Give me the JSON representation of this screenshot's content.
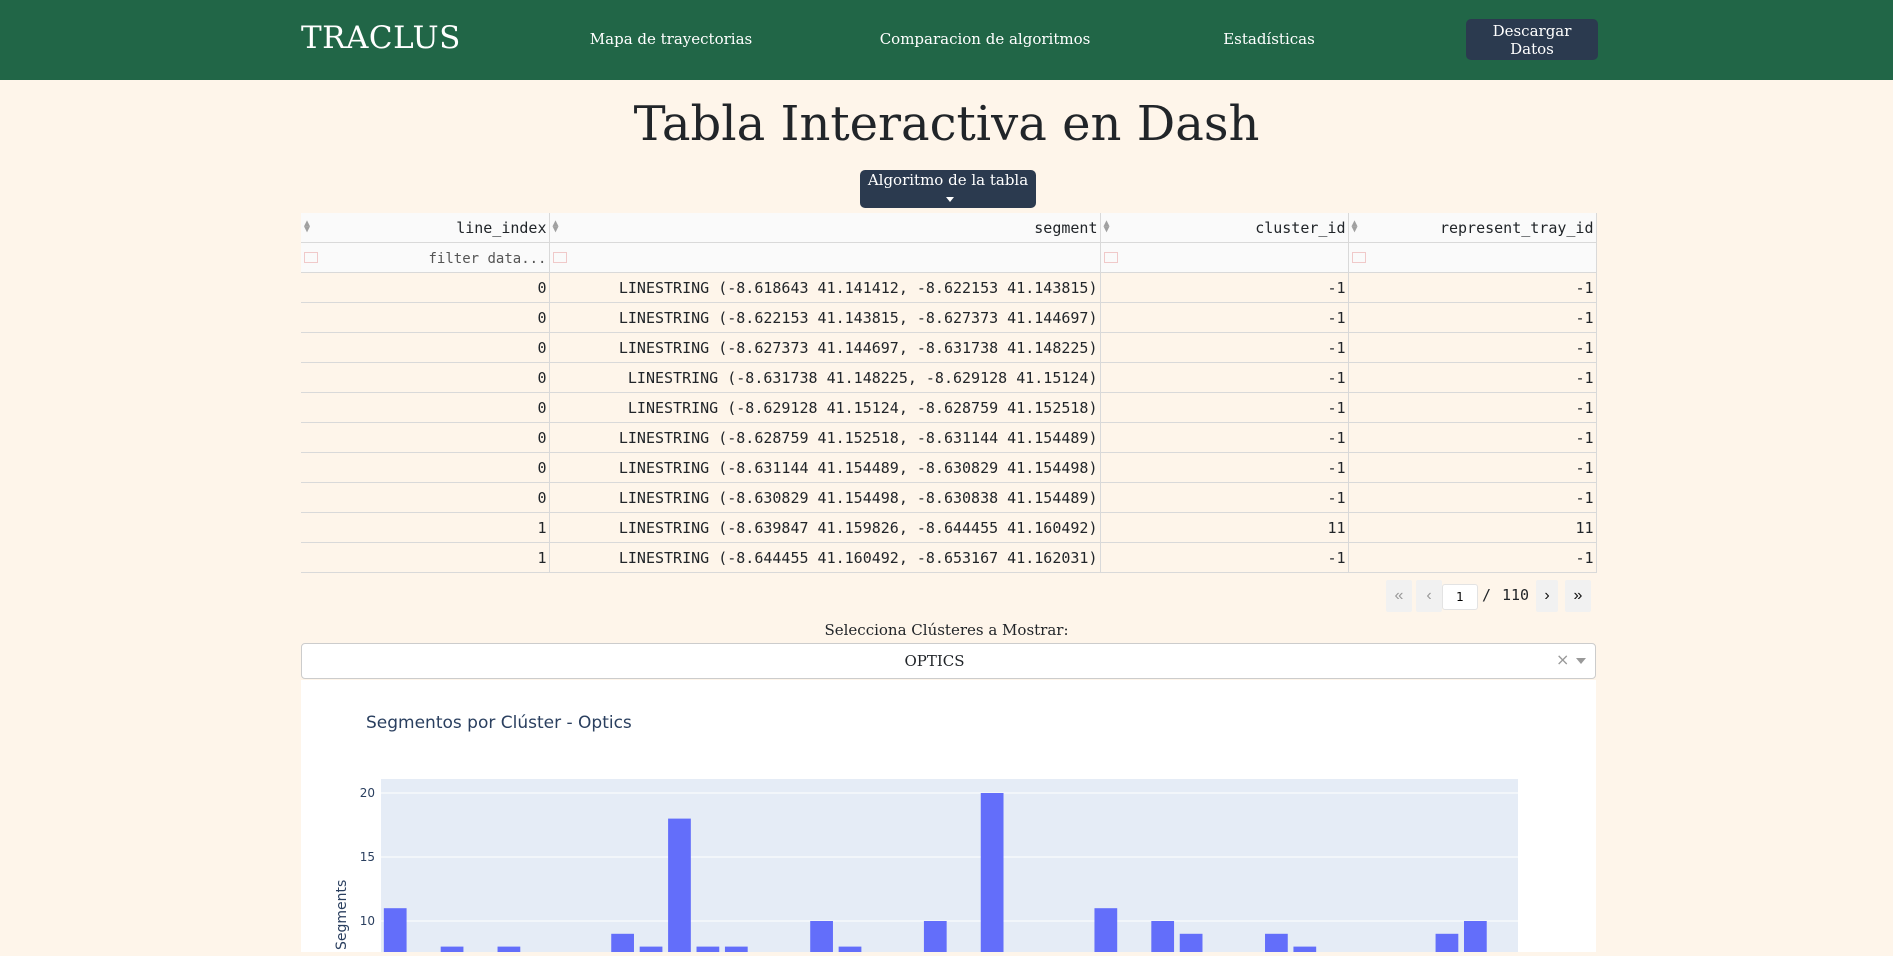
{
  "navbar": {
    "brand": "TRACLUS",
    "links": [
      "Mapa de trayectorias",
      "Comparacion de algoritmos",
      "Estadísticas"
    ],
    "download": "Descargar Datos"
  },
  "page_title": "Tabla Interactiva en Dash",
  "algorithm_dropdown": "Algoritmo de la tabla",
  "table": {
    "columns": [
      "line_index",
      "segment",
      "cluster_id",
      "represent_tray_id"
    ],
    "filter_placeholder": "filter data...",
    "rows": [
      [
        "0",
        "LINESTRING (-8.618643 41.141412, -8.622153 41.143815)",
        "-1",
        "-1"
      ],
      [
        "0",
        "LINESTRING (-8.622153 41.143815, -8.627373 41.144697)",
        "-1",
        "-1"
      ],
      [
        "0",
        "LINESTRING (-8.627373 41.144697, -8.631738 41.148225)",
        "-1",
        "-1"
      ],
      [
        "0",
        "LINESTRING (-8.631738 41.148225, -8.629128 41.15124)",
        "-1",
        "-1"
      ],
      [
        "0",
        "LINESTRING (-8.629128 41.15124, -8.628759 41.152518)",
        "-1",
        "-1"
      ],
      [
        "0",
        "LINESTRING (-8.628759 41.152518, -8.631144 41.154489)",
        "-1",
        "-1"
      ],
      [
        "0",
        "LINESTRING (-8.631144 41.154489, -8.630829 41.154498)",
        "-1",
        "-1"
      ],
      [
        "0",
        "LINESTRING (-8.630829 41.154498, -8.630838 41.154489)",
        "-1",
        "-1"
      ],
      [
        "1",
        "LINESTRING (-8.639847 41.159826, -8.644455 41.160492)",
        "11",
        "11"
      ],
      [
        "1",
        "LINESTRING (-8.644455 41.160492, -8.653167 41.162031)",
        "-1",
        "-1"
      ]
    ]
  },
  "pager": {
    "current": "1",
    "separator": "/",
    "total": "110"
  },
  "cluster_select": {
    "label": "Selecciona Clústeres a Mostrar:",
    "value": "OPTICS",
    "clear": "×"
  },
  "colors": {
    "navbar": "#216647",
    "button": "#2b3a4f",
    "bar": "#636efa",
    "plot_bg": "#e5ecf6",
    "page_bg": "#fef5ea"
  },
  "chart_data": {
    "type": "bar",
    "title": "Segmentos por Clúster - Optics",
    "ylabel": "Segments",
    "yticks": [
      10,
      15,
      20
    ],
    "values": [
      11,
      0,
      8,
      0,
      8,
      0,
      0,
      0,
      9,
      8,
      18,
      8,
      8,
      0,
      0,
      10,
      8,
      0,
      0,
      10,
      0,
      20,
      0,
      0,
      0,
      11,
      0,
      10,
      9,
      0,
      0,
      9,
      8,
      0,
      0,
      0,
      0,
      9,
      10,
      0
    ],
    "grid": true
  }
}
